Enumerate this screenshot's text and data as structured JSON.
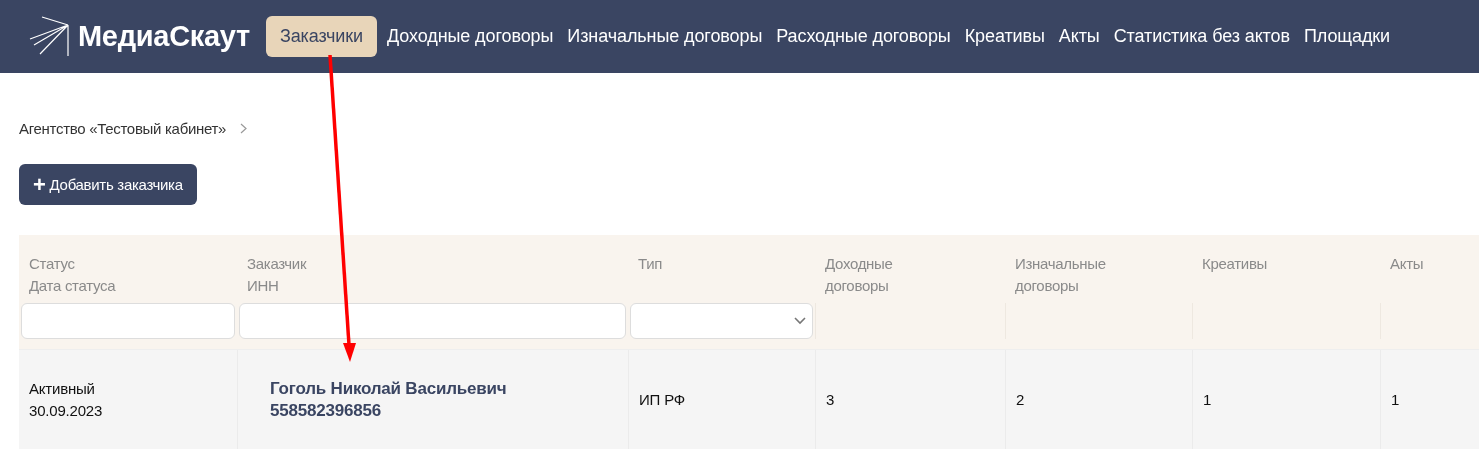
{
  "logo": {
    "text": "МедиаСкаут"
  },
  "nav": [
    {
      "label": "Заказчики",
      "selected": true
    },
    {
      "label": "Доходные договоры",
      "selected": false
    },
    {
      "label": "Изначальные договоры",
      "selected": false
    },
    {
      "label": "Расходные договоры",
      "selected": false
    },
    {
      "label": "Креативы",
      "selected": false
    },
    {
      "label": "Акты",
      "selected": false
    },
    {
      "label": "Статистика без актов",
      "selected": false
    },
    {
      "label": "Площадки",
      "selected": false
    }
  ],
  "breadcrumb": [
    "Агентство «Тестовый кабинет»"
  ],
  "add_button": {
    "icon": "+",
    "label": "Добавить заказчика"
  },
  "table": {
    "columns": [
      {
        "label": [
          "Статус",
          "Дата статуса"
        ],
        "filter": {
          "kind": "text"
        }
      },
      {
        "label": [
          "Заказчик",
          "ИНН"
        ],
        "filter": {
          "kind": "text"
        }
      },
      {
        "label": [
          "Тип"
        ],
        "filter": {
          "kind": "select"
        }
      },
      {
        "label": [
          "Доходные",
          "договоры"
        ]
      },
      {
        "label": [
          "Изначальные",
          "договоры"
        ]
      },
      {
        "label": [
          "Креативы"
        ]
      },
      {
        "label": [
          "Акты"
        ]
      }
    ],
    "rows": [
      {
        "cells": [
          {
            "kind": "plain",
            "lines": [
              "Активный",
              "30.09.2023"
            ]
          },
          {
            "kind": "strong",
            "lines": [
              "Гоголь Николай Васильевич",
              "558582396856"
            ]
          },
          {
            "kind": "plain",
            "lines": [
              "ИП РФ"
            ]
          },
          {
            "kind": "plain",
            "lines": [
              "3"
            ]
          },
          {
            "kind": "plain",
            "lines": [
              "2"
            ]
          },
          {
            "kind": "plain",
            "lines": [
              "1"
            ]
          },
          {
            "kind": "plain",
            "lines": [
              "1"
            ]
          }
        ]
      }
    ]
  },
  "annotation": {
    "kind": "arrow"
  }
}
